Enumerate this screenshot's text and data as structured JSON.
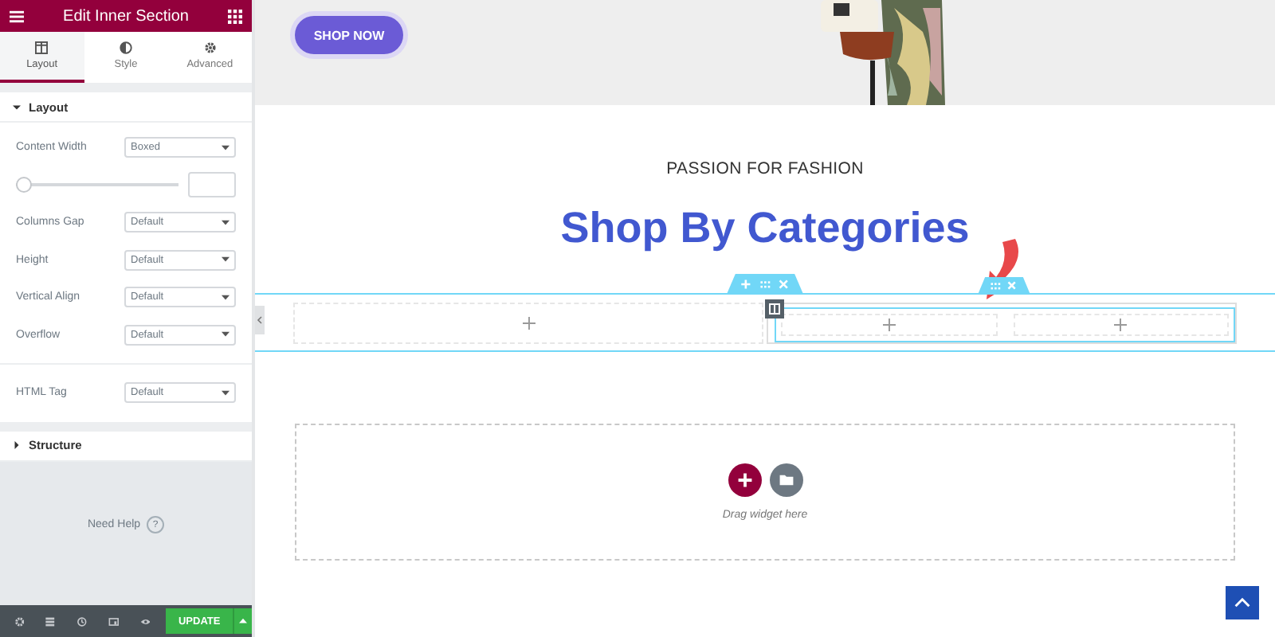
{
  "panel": {
    "title": "Edit Inner Section",
    "tabs": [
      {
        "kind": "layout",
        "label": "Layout",
        "selected": true
      },
      {
        "kind": "style",
        "label": "Style",
        "selected": false
      },
      {
        "kind": "advanced",
        "label": "Advanced",
        "selected": false
      }
    ],
    "sections": [
      {
        "title": "Layout",
        "expanded": true,
        "groups": [
          [
            {
              "kind": "select",
              "label": "Content Width",
              "value": "Boxed"
            },
            {
              "kind": "slider",
              "level": 0
            },
            {
              "kind": "select",
              "label": "Columns Gap",
              "value": "Default"
            },
            {
              "kind": "select",
              "label": "Height",
              "value": "Default"
            },
            {
              "kind": "select",
              "label": "Vertical Align",
              "value": "Default"
            },
            {
              "kind": "select",
              "label": "Overflow",
              "value": "Default"
            }
          ],
          [
            {
              "kind": "select",
              "label": "HTML Tag",
              "value": "Default"
            }
          ]
        ]
      },
      {
        "title": "Structure",
        "expanded": false
      }
    ],
    "help": "Need Help",
    "help_mark": "?",
    "update_button": "UPDATE"
  },
  "canvas": {
    "hero": {
      "button": "SHOP NOW"
    },
    "kicker": "PASSION FOR FASHION",
    "heading": "Shop By Categories",
    "drop_hint": "Drag widget here"
  }
}
